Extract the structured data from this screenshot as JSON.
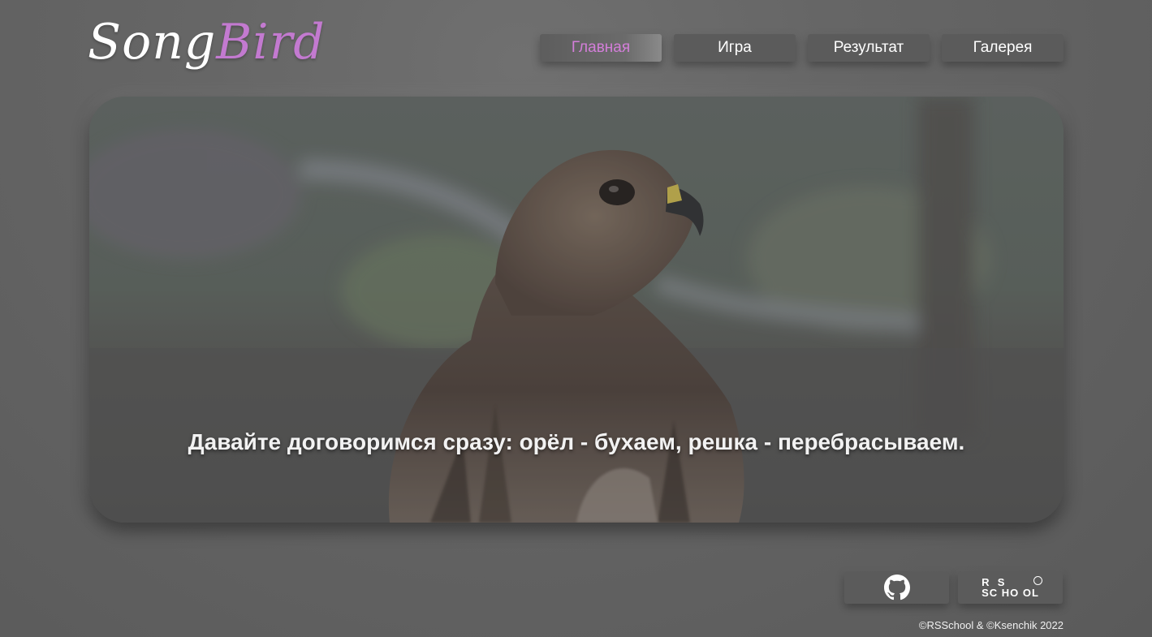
{
  "logo": {
    "part1": "Song",
    "part2": "Bird"
  },
  "nav": {
    "items": [
      {
        "label": "Главная",
        "active": true
      },
      {
        "label": "Игра",
        "active": false
      },
      {
        "label": "Результат",
        "active": false
      },
      {
        "label": "Галерея",
        "active": false
      }
    ]
  },
  "hero": {
    "caption": "Давайте договоримся сразу: орёл - бухаем, решка - перебрасываем.",
    "image": "hawk-photo"
  },
  "footer": {
    "github_icon": "github-icon",
    "rs_school_logo": {
      "row1": "R  S",
      "row2": "SC HO OL"
    },
    "copyright": "©RSSchool & ©Ksenchik 2022"
  },
  "colors": {
    "accent": "#c37ad0",
    "active_nav": "#d37ed9",
    "background": "#666666",
    "button": "#5b5b5b"
  }
}
